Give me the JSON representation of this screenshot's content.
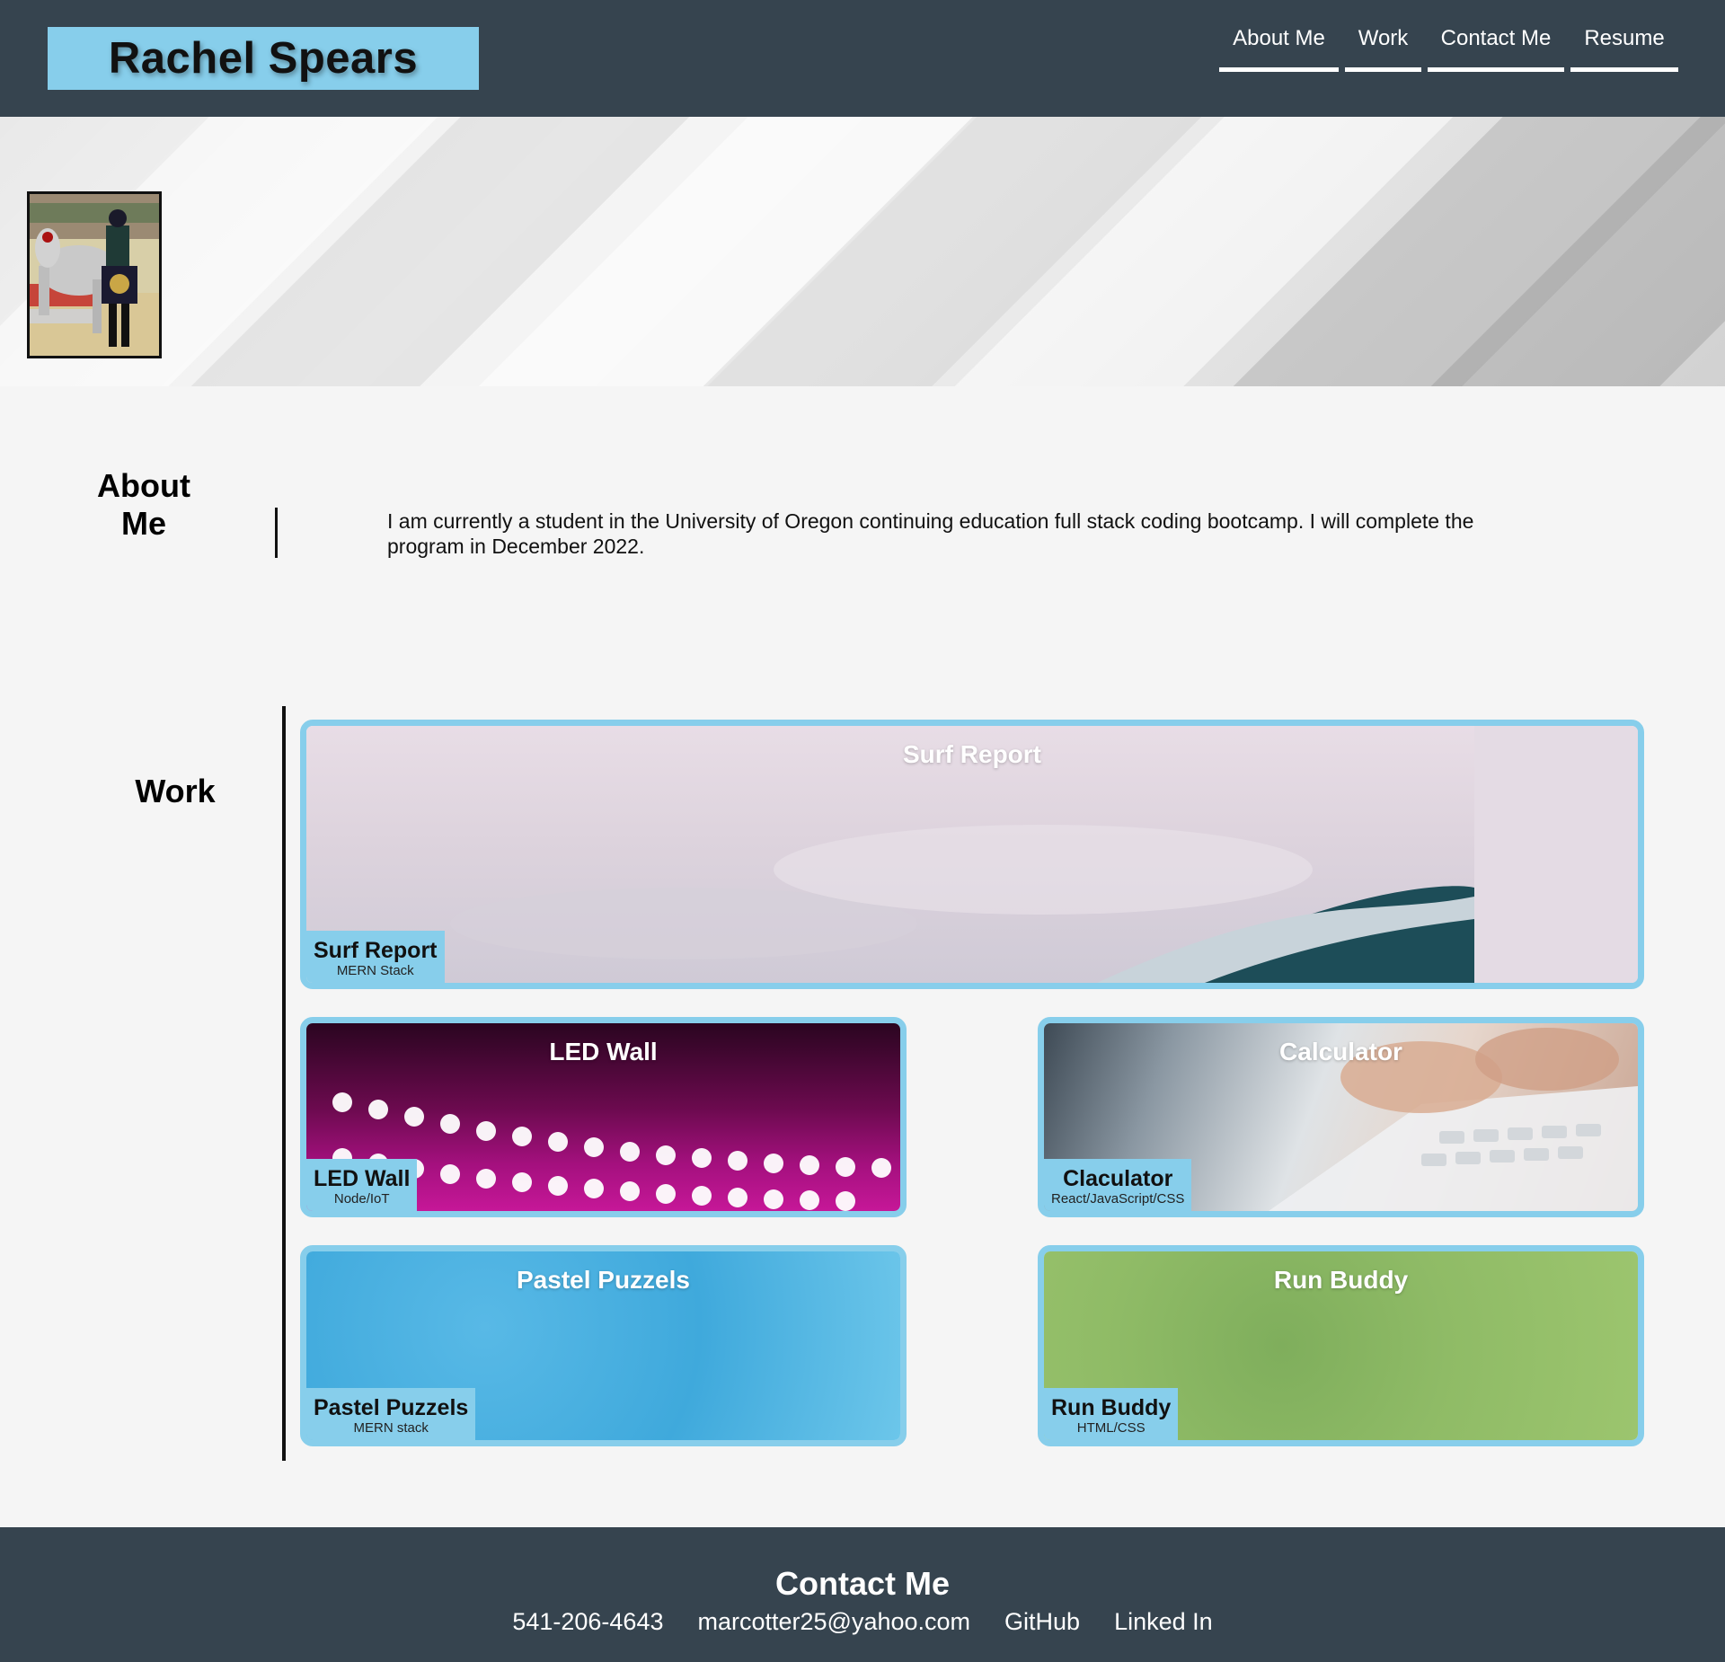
{
  "header": {
    "brand_name": "Rachel Spears",
    "nav": [
      "About Me",
      "Work",
      "Contact Me",
      "Resume"
    ]
  },
  "about": {
    "heading": "About Me",
    "text": "I am currently a student in the University of Oregon continuing education full stack coding bootcamp. I will complete the program in December 2022."
  },
  "work": {
    "heading": "Work",
    "projects": [
      {
        "title": "Surf Report",
        "label": "Surf Report",
        "stack": "MERN Stack"
      },
      {
        "title": "LED Wall",
        "label": "LED Wall",
        "stack": "Node/IoT"
      },
      {
        "title": "Calculator",
        "label": "Claculator",
        "stack": "React/JavaScript/CSS"
      },
      {
        "title": "Pastel Puzzels",
        "label": "Pastel Puzzels",
        "stack": "MERN stack"
      },
      {
        "title": "Run Buddy",
        "label": "Run Buddy",
        "stack": "HTML/CSS"
      }
    ]
  },
  "footer": {
    "title": "Contact Me",
    "links": [
      "541-206-4643",
      "marcotter25@yahoo.com",
      "GitHub",
      "Linked In"
    ]
  },
  "colors": {
    "header_bg": "#36444f",
    "accent": "#87ceeb",
    "page_bg": "#f5f5f5"
  },
  "icons": [
    "profile-photo-image",
    "hero-banner-image"
  ]
}
